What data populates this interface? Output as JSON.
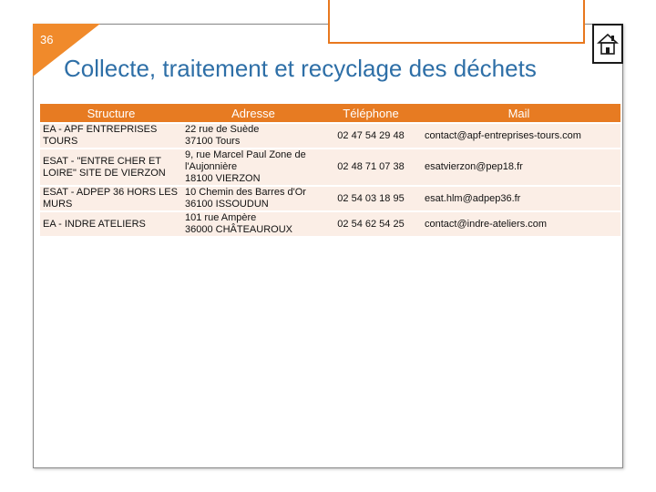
{
  "slide": {
    "number": "36",
    "title": "Collecte, traitement et recyclage des déchets"
  },
  "table": {
    "headers": [
      "Structure",
      "Adresse",
      "Téléphone",
      "Mail"
    ],
    "rows": [
      {
        "structure": "EA - APF ENTREPRISES TOURS",
        "address": [
          "22 rue de Suède",
          "37100 Tours"
        ],
        "phone": "02 47 54 29 48",
        "mail": "contact@apf-entreprises-tours.com"
      },
      {
        "structure": "ESAT - \"ENTRE CHER ET LOIRE\" SITE DE VIERZON",
        "address": [
          "9, rue Marcel Paul Zone de l'Aujonnière",
          "18100 VIERZON"
        ],
        "phone": "02 48 71 07 38",
        "mail": "esatvierzon@pep18.fr"
      },
      {
        "structure": "ESAT - ADPEP 36 HORS LES MURS",
        "address": [
          "10 Chemin des Barres d'Or",
          "36100 ISSOUDUN"
        ],
        "phone": "02 54 03 18 95",
        "mail": "esat.hlm@adpep36.fr"
      },
      {
        "structure": "EA - INDRE ATELIERS",
        "address": [
          "101 rue Ampère",
          "36000 CHÂTEAUROUX"
        ],
        "phone": "02 54 62 54 25",
        "mail": "contact@indre-ateliers.com"
      }
    ]
  },
  "colors": {
    "accent": "#e77b22",
    "title": "#2e6fa7",
    "row_bg": "#fbeee6"
  }
}
